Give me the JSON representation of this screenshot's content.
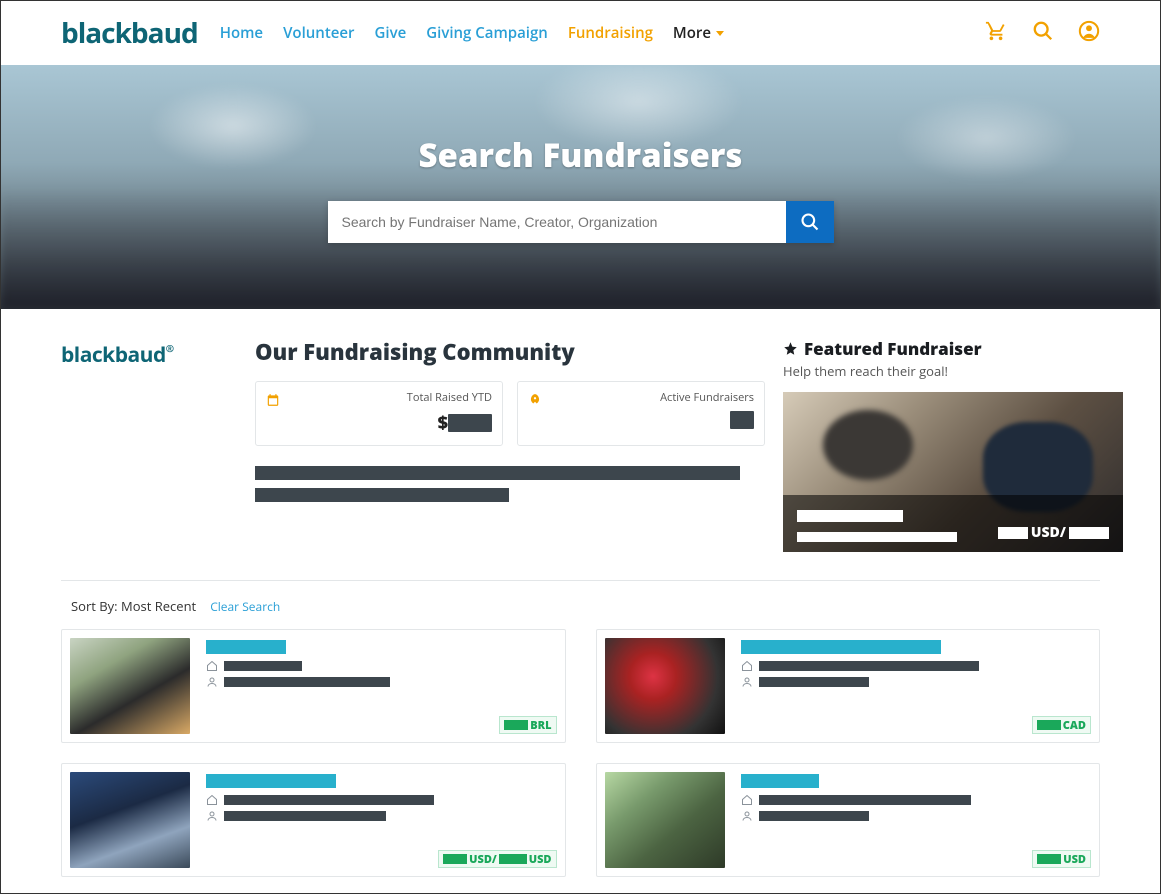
{
  "brand": "blackbaud",
  "nav": {
    "home": "Home",
    "volunteer": "Volunteer",
    "give": "Give",
    "giving_campaign": "Giving Campaign",
    "fundraising": "Fundraising",
    "more": "More"
  },
  "hero": {
    "title": "Search Fundraisers",
    "search_placeholder": "Search by Fundraiser Name, Creator, Organization"
  },
  "side_brand": "blackbaud",
  "community": {
    "heading": "Our Fundraising Community",
    "stats": {
      "total_raised_label": "Total Raised YTD",
      "total_raised_prefix": "$",
      "active_label": "Active Fundraisers"
    }
  },
  "featured": {
    "title": "Featured Fundraiser",
    "subtitle": "Help them reach their goal!",
    "goal_sep": "USD/"
  },
  "sort": {
    "prefix": "Sort By:",
    "value": "Most Recent",
    "clear": "Clear Search"
  },
  "cards": {
    "c1_currency": "BRL",
    "c2_currency": "CAD",
    "c3_currency_a": "USD/",
    "c3_currency_b": "USD",
    "c4_currency": "USD"
  }
}
